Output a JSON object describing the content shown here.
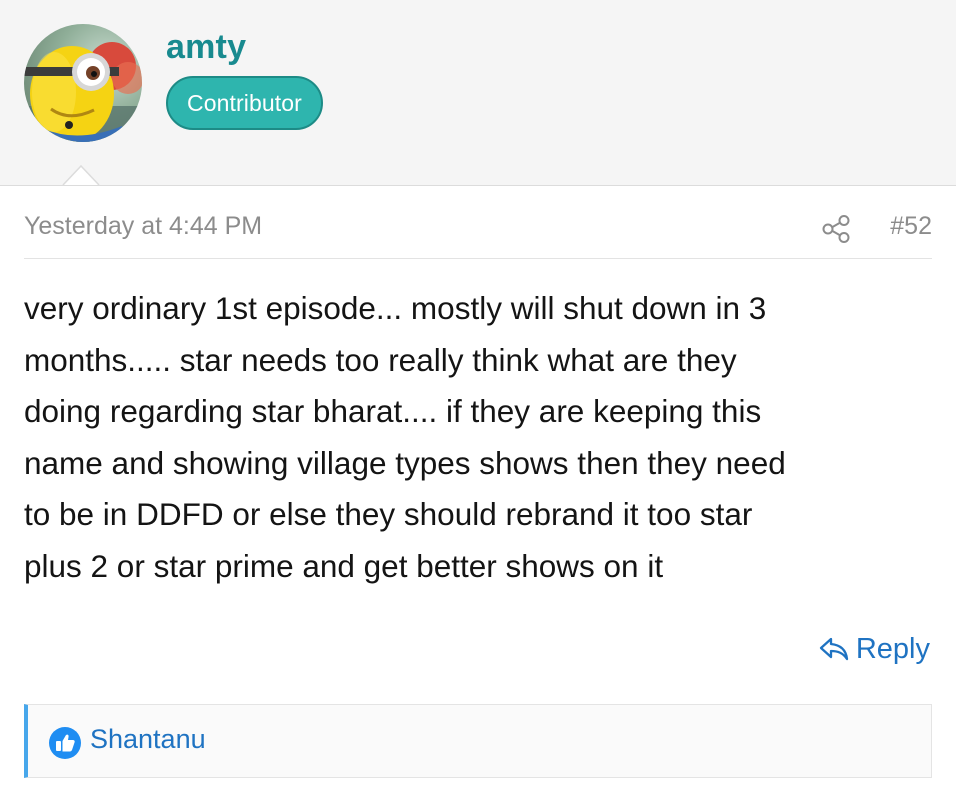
{
  "user": {
    "name": "amty",
    "role": "Contributor",
    "avatar_icon": "minion-avatar"
  },
  "post": {
    "timestamp": "Yesterday at 4:44 PM",
    "number": "#52",
    "body": "very ordinary 1st episode... mostly will shut down in 3\nmonths..... star needs too really think what are they\ndoing regarding star bharat.... if they are keeping this\nname and showing village types shows then they need\nto be in DDFD or else they should rebrand it too star\nplus 2 or star prime and get better shows on it",
    "share_icon": "share-icon"
  },
  "actions": {
    "reply_label": "Reply",
    "reply_icon": "reply-icon"
  },
  "reactions": {
    "icon": "like-icon",
    "users": "Shantanu"
  },
  "colors": {
    "username": "#188a8f",
    "badge": "#2eb5ae",
    "link": "#1f73c2",
    "reaction_accent": "#47a7eb"
  }
}
